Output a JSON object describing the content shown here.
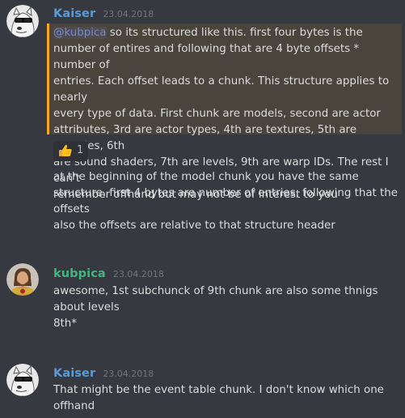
{
  "colors": {
    "background": "#36393f",
    "mention_highlight_bg": "#49443c",
    "mention_border": "#faa61a",
    "mention_tag": "#7289da",
    "kaiser_name": "#5b9bd5",
    "kubpica_name": "#43b581",
    "timestamp": "#72767d",
    "text": "#dcddde"
  },
  "messages": [
    {
      "author": "Kaiser",
      "timestamp": "23.04.2018",
      "avatar_icon": "sunglasses-doge-avatar",
      "mention": "@kubpica",
      "highlighted_text": " so its structured like this. first four bytes is the\nnumber of entires and following that are 4 byte offsets * number of\nentries. Each offset leads to a chunk. This structure applies to nearly\nevery type of data. First chunk are models, second are actor\nattributes, 3rd are actor types, 4th are textures, 5th are particles, 6th\nare sound shaders, 7th are levels, 9th are warp IDs. The rest I can't\nremember offhand but may not be of interest to you",
      "reaction": {
        "emoji": "thumbs-up-icon",
        "count": "1"
      },
      "text_2": "at the beginning of the model chunk you have the same\nstructure. first 4 bytes are number of entries, following that the\noffsets",
      "text_3": "also the offsets are relative to that structure header"
    },
    {
      "author": "kubpica",
      "timestamp": "23.04.2018",
      "avatar_icon": "wrestler-avatar",
      "text_1": "awesome, 1st subchunck of 9th chunk are also some thnigs\nabout levels",
      "text_2": "8th*"
    },
    {
      "author": "Kaiser",
      "timestamp": "23.04.2018",
      "avatar_icon": "sunglasses-doge-avatar",
      "text_1": "That might be the event table chunk. I don't know which one\noffhand"
    }
  ]
}
